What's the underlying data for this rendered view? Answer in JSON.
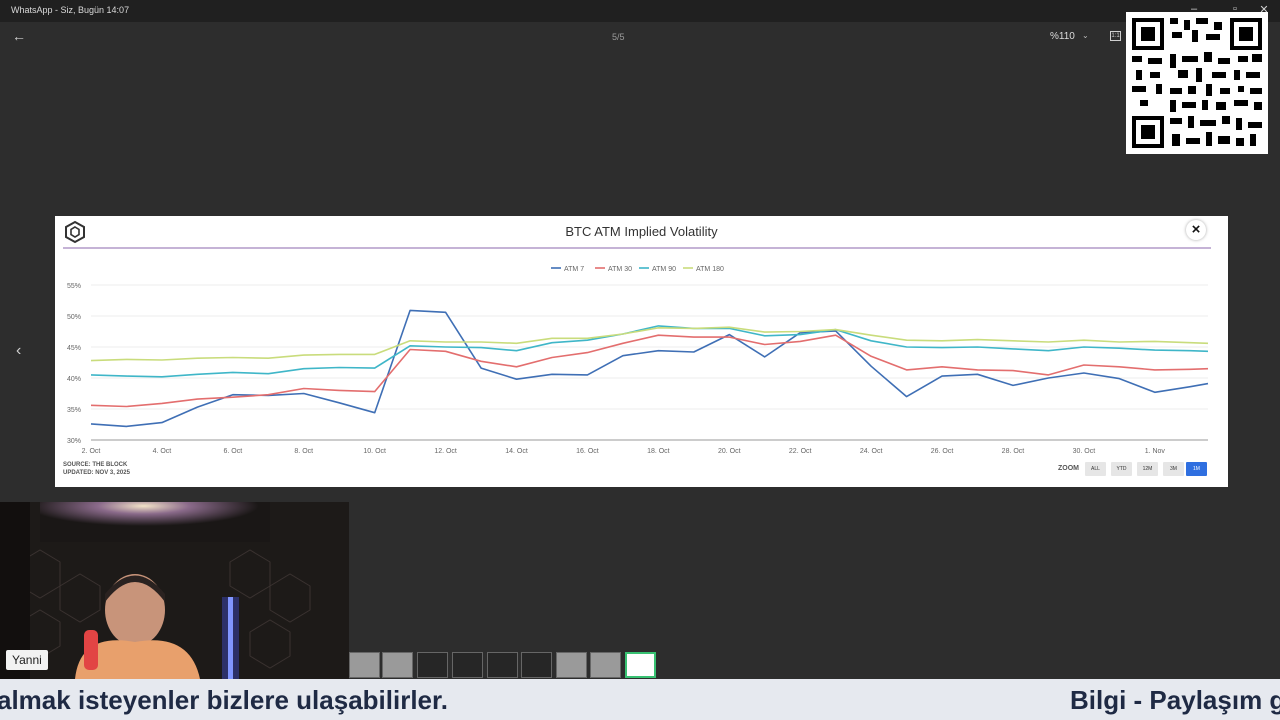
{
  "window": {
    "title": "WhatsApp - Siz, Bugün 14:07",
    "page_counter": "5/5",
    "zoom_level": "%110"
  },
  "chart_data": {
    "type": "line",
    "title": "BTC ATM Implied Volatility",
    "x_ticks": [
      "2. Oct",
      "4. Oct",
      "6. Oct",
      "8. Oct",
      "10. Oct",
      "12. Oct",
      "14. Oct",
      "16. Oct",
      "18. Oct",
      "20. Oct",
      "22. Oct",
      "24. Oct",
      "26. Oct",
      "28. Oct",
      "30. Oct",
      "1. Nov"
    ],
    "y_ticks": [
      "30%",
      "35%",
      "40%",
      "45%",
      "50%",
      "55%"
    ],
    "ylim": [
      30,
      55
    ],
    "x_range_days": [
      0,
      31.5
    ],
    "legend_position": "top-center",
    "grid": true,
    "series": [
      {
        "name": "ATM 7",
        "color": "#3f6fb5",
        "x": [
          0,
          1,
          2,
          3,
          4,
          5,
          6,
          7,
          8,
          9,
          10,
          11,
          12,
          13,
          14,
          15,
          16,
          17,
          18,
          19,
          20,
          21,
          22,
          23,
          24,
          25,
          26,
          27,
          28,
          29,
          30,
          31,
          31.5
        ],
        "values": [
          32.6,
          32.2,
          32.8,
          35.3,
          37.3,
          37.2,
          37.5,
          36.0,
          34.4,
          50.9,
          50.6,
          41.6,
          39.8,
          40.6,
          40.5,
          43.6,
          44.4,
          44.2,
          47.0,
          43.4,
          47.3,
          47.6,
          41.9,
          37.0,
          40.3,
          40.6,
          38.8,
          40.0,
          40.8,
          39.9,
          37.7,
          38.6,
          39.1
        ]
      },
      {
        "name": "ATM 30",
        "color": "#e36e6e",
        "x": [
          0,
          1,
          2,
          3,
          4,
          5,
          6,
          7,
          8,
          9,
          10,
          11,
          12,
          13,
          14,
          15,
          16,
          17,
          18,
          19,
          20,
          21,
          22,
          23,
          24,
          25,
          26,
          27,
          28,
          29,
          30,
          31,
          31.5
        ],
        "values": [
          35.6,
          35.4,
          35.9,
          36.6,
          36.9,
          37.3,
          38.3,
          38.0,
          37.8,
          44.6,
          44.3,
          42.7,
          41.8,
          43.3,
          44.1,
          45.6,
          46.9,
          46.6,
          46.6,
          45.4,
          45.9,
          46.9,
          43.5,
          41.3,
          41.8,
          41.3,
          41.2,
          40.5,
          42.1,
          41.8,
          41.3,
          41.4,
          41.5
        ]
      },
      {
        "name": "ATM 90",
        "color": "#3fb6c8",
        "x": [
          0,
          1,
          2,
          3,
          4,
          5,
          6,
          7,
          8,
          9,
          10,
          11,
          12,
          13,
          14,
          15,
          16,
          17,
          18,
          19,
          20,
          21,
          22,
          23,
          24,
          25,
          26,
          27,
          28,
          29,
          30,
          31,
          31.5
        ],
        "values": [
          40.5,
          40.3,
          40.2,
          40.6,
          40.9,
          40.7,
          41.5,
          41.7,
          41.6,
          45.2,
          45.0,
          44.9,
          44.4,
          45.7,
          46.1,
          47.1,
          48.4,
          48.0,
          48.0,
          46.8,
          47.0,
          47.8,
          46.0,
          45.0,
          44.9,
          45.0,
          44.7,
          44.4,
          45.0,
          44.8,
          44.5,
          44.4,
          44.3
        ]
      },
      {
        "name": "ATM 180",
        "color": "#c9dc7c",
        "x": [
          0,
          1,
          2,
          3,
          4,
          5,
          6,
          7,
          8,
          9,
          10,
          11,
          12,
          13,
          14,
          15,
          16,
          17,
          18,
          19,
          20,
          21,
          22,
          23,
          24,
          25,
          26,
          27,
          28,
          29,
          30,
          31,
          31.5
        ],
        "values": [
          42.8,
          43.0,
          42.9,
          43.2,
          43.3,
          43.2,
          43.7,
          43.8,
          43.8,
          46.0,
          45.8,
          45.8,
          45.6,
          46.4,
          46.4,
          47.1,
          48.1,
          48.0,
          48.2,
          47.4,
          47.5,
          47.8,
          46.9,
          46.1,
          46.0,
          46.2,
          46.0,
          45.8,
          46.1,
          45.8,
          45.9,
          45.7,
          45.6
        ]
      }
    ],
    "source_line1": "SOURCE: THE BLOCK",
    "source_line2": "UPDATED: NOV 3, 2025",
    "zoom_label": "ZOOM",
    "zoom_buttons": [
      "ALL",
      "YTD",
      "12M",
      "3M",
      "1M"
    ],
    "zoom_active": "1M"
  },
  "webcam": {
    "name": "Yanni"
  },
  "ticker": {
    "text_left": "almak isteyenler bizlere ulaşabilirler.",
    "text_right": "Bilgi - Paylaşım gr"
  },
  "icons": [
    "back-arrow-icon",
    "chevron-down-icon",
    "actual-size-icon",
    "close-icon",
    "the-block-logo-icon",
    "prev-arrow-icon"
  ],
  "colors": {
    "accent_blue": "#2f6fe0",
    "ticker_bg": "#e6e9ef",
    "ticker_text": "#1f2a44"
  }
}
